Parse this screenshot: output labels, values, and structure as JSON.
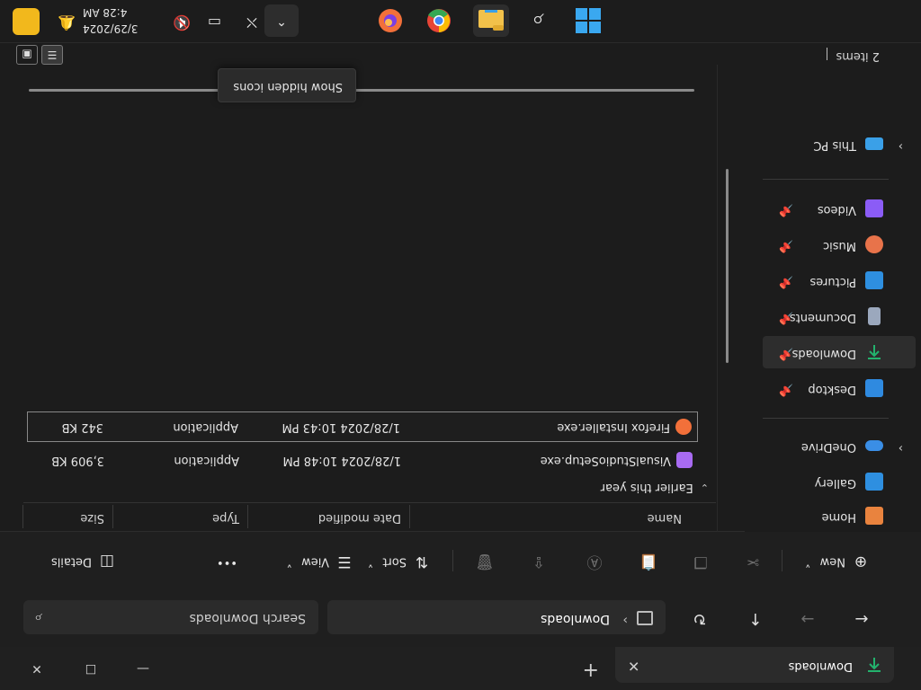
{
  "window": {
    "tab_title": "Downloads",
    "minimize_glyph": "—",
    "maximize_glyph": "☐",
    "close_glyph": "✕",
    "tab_close_glyph": "✕",
    "new_tab_glyph": "+"
  },
  "address": {
    "breadcrumb": "Downloads",
    "separator": "›",
    "search_placeholder": "Search Downloads",
    "back_glyph": "←",
    "forward_glyph": "→",
    "up_glyph": "↑",
    "refresh_glyph": "↻"
  },
  "toolbar": {
    "new_label": "New",
    "sort_label": "Sort",
    "view_label": "View",
    "more_label": "•••",
    "details_label": "Details",
    "dropdown_glyph": "˅"
  },
  "sidebar": {
    "items": [
      {
        "label": "Home",
        "icon": "home-icon",
        "color": "#e9833e"
      },
      {
        "label": "Gallery",
        "icon": "gallery-icon",
        "color": "#2e8fe0"
      },
      {
        "label": "OneDrive",
        "icon": "onedrive-icon",
        "color": "#3a8ee6"
      },
      {
        "label": "Desktop",
        "icon": "desktop-icon",
        "color": "#2f8ae0",
        "pinned": true
      },
      {
        "label": "Downloads",
        "icon": "downloads-icon",
        "color": "#23b26d",
        "pinned": true,
        "active": true
      },
      {
        "label": "Documents",
        "icon": "documents-icon",
        "color": "#9ba8bd",
        "pinned": true
      },
      {
        "label": "Pictures",
        "icon": "pictures-icon",
        "color": "#2e8fe0",
        "pinned": true
      },
      {
        "label": "Music",
        "icon": "music-icon",
        "color": "#e8734a",
        "pinned": true
      },
      {
        "label": "Videos",
        "icon": "videos-icon",
        "color": "#8b5cf6",
        "pinned": true
      },
      {
        "label": "This PC",
        "icon": "this-pc-icon",
        "color": "#3aa0e8"
      }
    ]
  },
  "files": {
    "columns": [
      "Name",
      "Date modified",
      "Type",
      "Size"
    ],
    "group_label": "Earlier this year",
    "rows": [
      {
        "name": "VisualStudioSetup.exe",
        "date": "1/28/2024 10:48 PM",
        "type": "Application",
        "size": "3,909 KB",
        "icon": "visual-studio-icon",
        "color": "#a86bf2"
      },
      {
        "name": "Firefox Installer.exe",
        "date": "1/28/2024 10:43 PM",
        "type": "Application",
        "size": "342 KB",
        "icon": "firefox-icon",
        "color": "#f2703a",
        "selected": true
      }
    ]
  },
  "status": {
    "item_count": "2 items"
  },
  "tooltip": {
    "text": "Show hidden icons"
  },
  "taskbar": {
    "date": "3/29/2024",
    "time": "4:28 AM",
    "chevron_glyph": "⌃",
    "apps": [
      {
        "name": "start-button",
        "icon": "windows-logo-icon"
      },
      {
        "name": "search-button",
        "icon": "search-icon"
      },
      {
        "name": "file-explorer-button",
        "icon": "folder-icon",
        "active": true
      },
      {
        "name": "chrome-button",
        "icon": "chrome-icon"
      },
      {
        "name": "firefox-button",
        "icon": "firefox-icon"
      }
    ]
  }
}
